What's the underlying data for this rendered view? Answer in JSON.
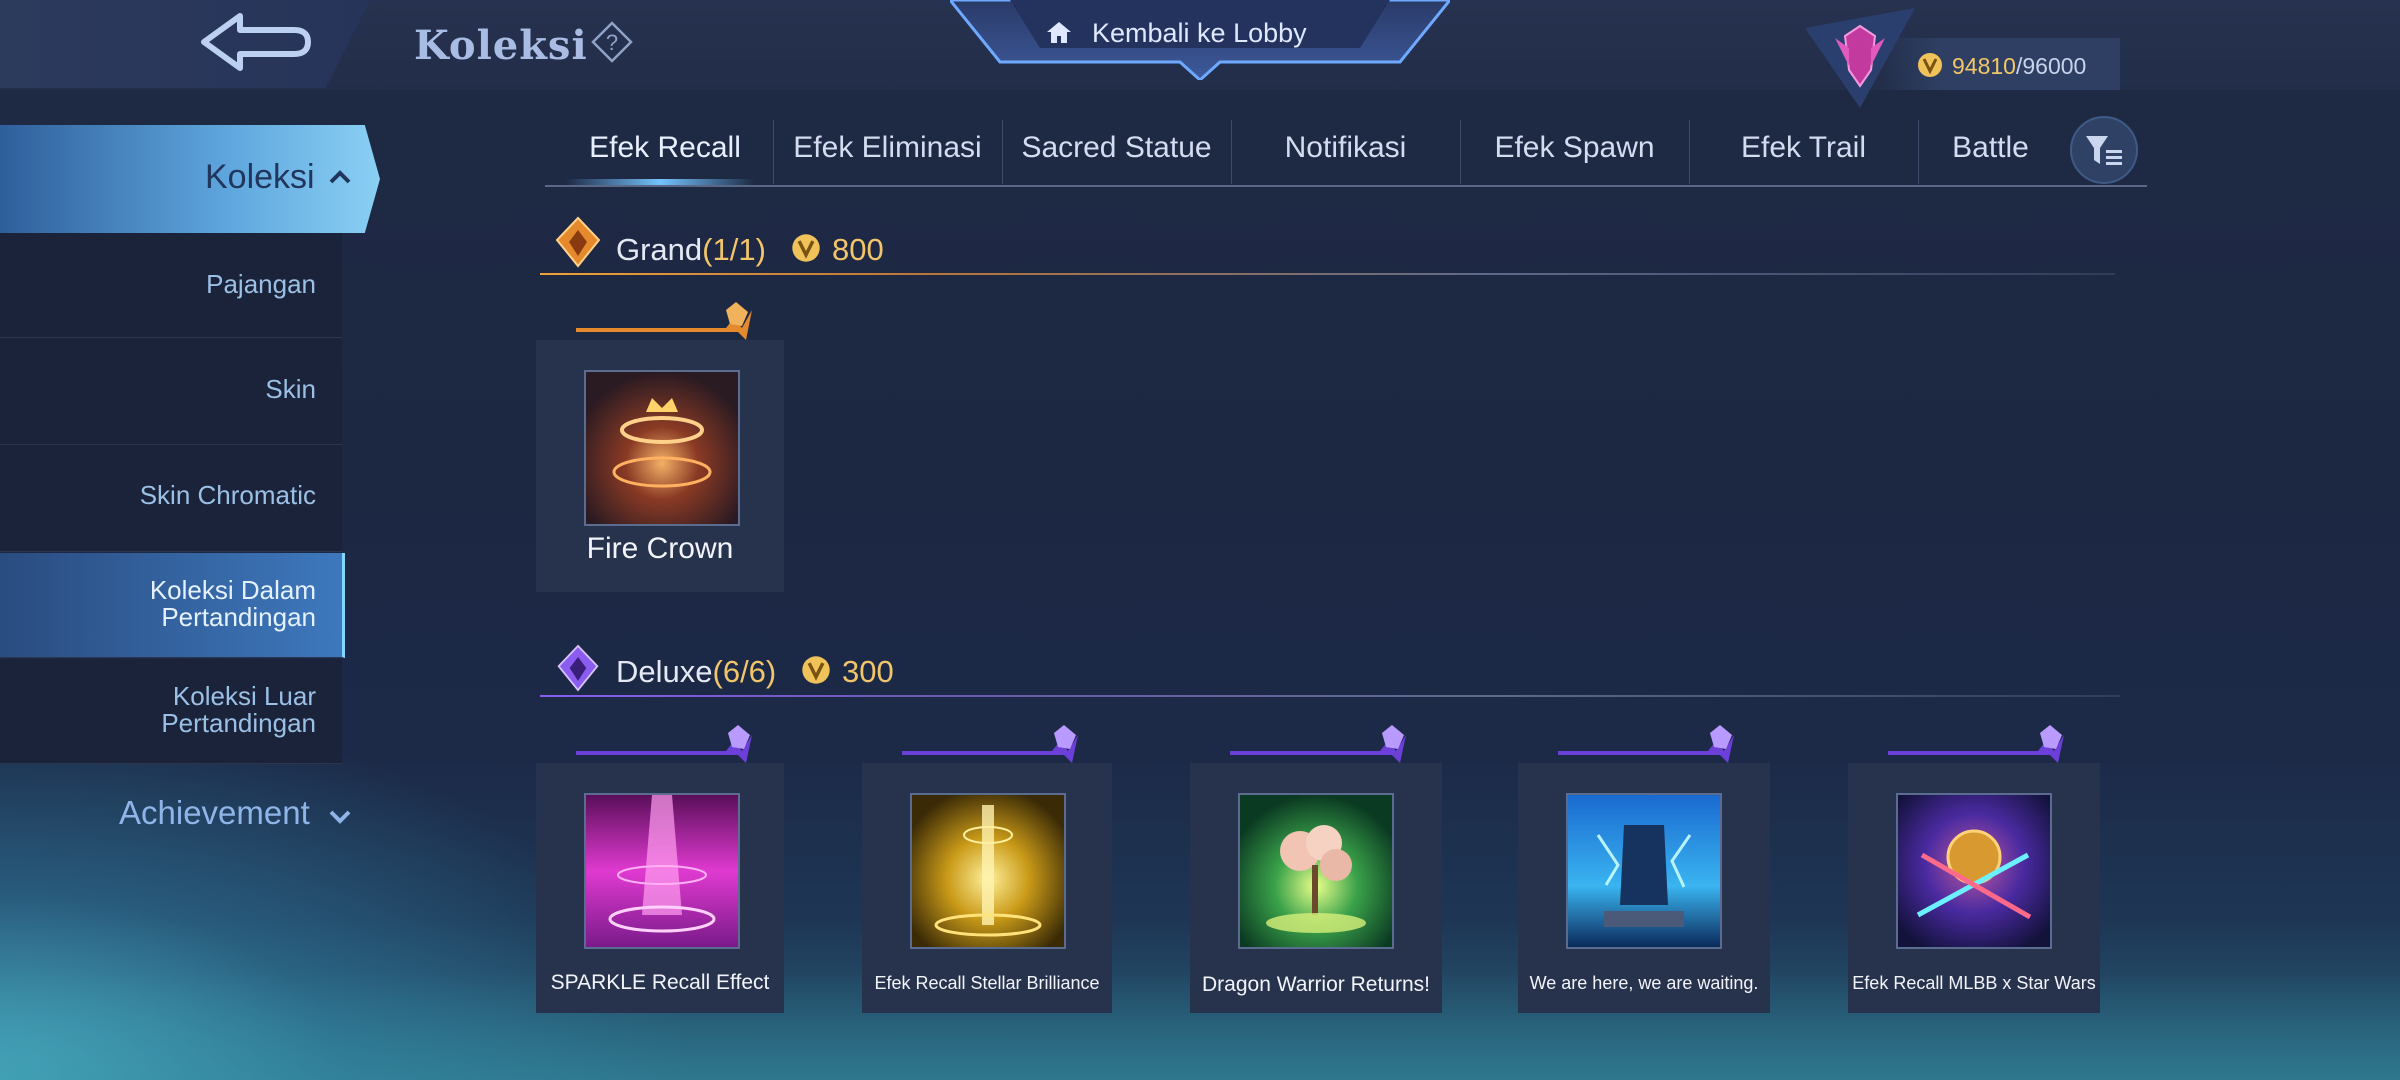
{
  "header": {
    "title": "Koleksi",
    "lobby_label": "Kembali ke Lobby",
    "currency": {
      "current": "94810",
      "separator": "/",
      "max": "96000"
    }
  },
  "sidebar": {
    "main_label": "Koleksi",
    "items": [
      {
        "label": "Pajangan"
      },
      {
        "label": "Skin"
      },
      {
        "label": "Skin Chromatic"
      },
      {
        "label": "Koleksi Dalam Pertandingan",
        "active": true
      },
      {
        "label": "Koleksi Luar Pertandingan"
      }
    ],
    "achievement_label": "Achievement"
  },
  "tabs": [
    "Efek Recall",
    "Efek Eliminasi",
    "Sacred Statue",
    "Notifikasi",
    "Efek Spawn",
    "Efek Trail",
    "Battle"
  ],
  "active_tab": "Efek Recall",
  "sections": {
    "grand": {
      "name": "Grand",
      "count": "(1/1)",
      "price": "800",
      "accent": "#f0a13a",
      "items": [
        {
          "name": "Fire Crown"
        }
      ]
    },
    "deluxe": {
      "name": "Deluxe",
      "count": "(6/6)",
      "price": "300",
      "accent": "#8a5cf0",
      "items": [
        {
          "name": "SPARKLE Recall Effect"
        },
        {
          "name": "Efek Recall Stellar Brilliance"
        },
        {
          "name": "Dragon Warrior Returns!"
        },
        {
          "name": "We are here, we are waiting."
        },
        {
          "name": "Efek Recall MLBB x Star Wars"
        }
      ]
    }
  }
}
